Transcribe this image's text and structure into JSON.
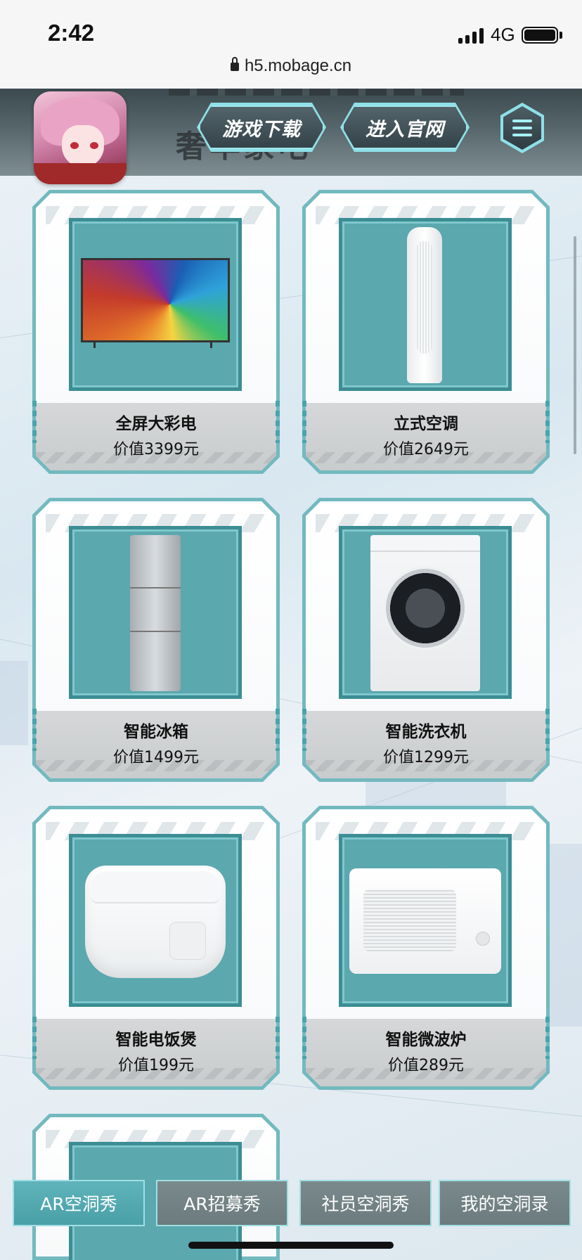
{
  "status_bar": {
    "time": "2:42",
    "network": "4G"
  },
  "browser": {
    "url": "h5.mobage.cn"
  },
  "header": {
    "banner_text": "奢华家电",
    "download_button": "游戏下载",
    "official_site_button": "进入官网"
  },
  "products": [
    {
      "name": "全屏大彩电",
      "value": "价值3399元",
      "icon": "tv"
    },
    {
      "name": "立式空调",
      "value": "价值2649元",
      "icon": "air-conditioner"
    },
    {
      "name": "智能冰箱",
      "value": "价值1499元",
      "icon": "fridge"
    },
    {
      "name": "智能洗衣机",
      "value": "价值1299元",
      "icon": "washing-machine"
    },
    {
      "name": "智能电饭煲",
      "value": "价值199元",
      "icon": "rice-cooker"
    },
    {
      "name": "智能微波炉",
      "value": "价值289元",
      "icon": "microwave"
    }
  ],
  "tabs": [
    {
      "label": "AR空洞秀",
      "active": true
    },
    {
      "label": "AR招募秀",
      "active": false
    },
    {
      "label": "社员空洞秀",
      "active": false
    },
    {
      "label": "我的空洞录",
      "active": false
    }
  ],
  "colors": {
    "accent": "#5ba8ae",
    "frame": "#72b9bf",
    "caption_bg": "#d0d3d4"
  }
}
